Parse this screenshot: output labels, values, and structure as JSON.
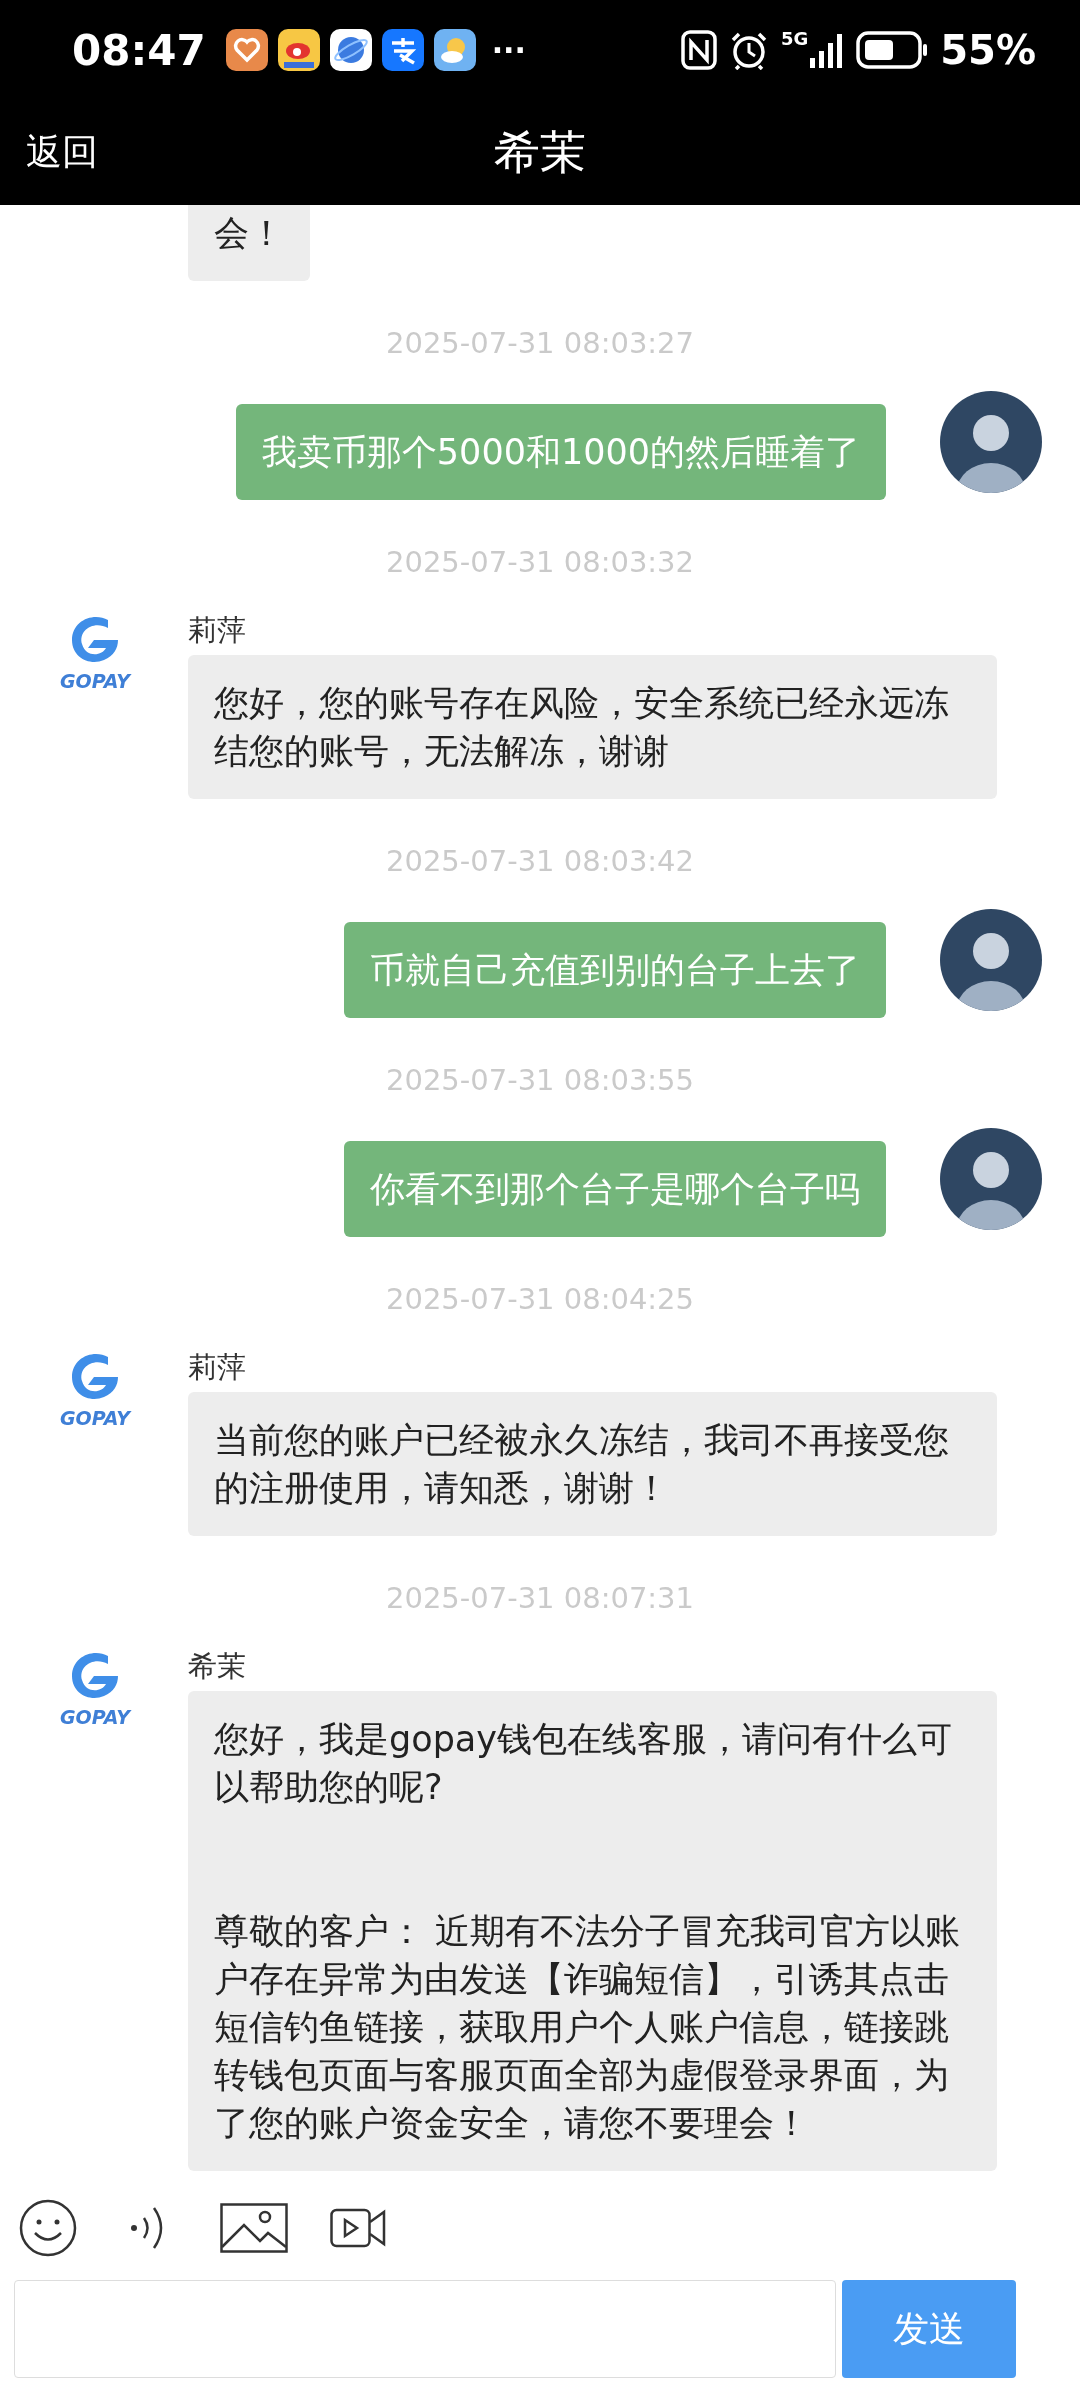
{
  "status_bar": {
    "time": "08:47",
    "overflow": "···",
    "network": "5G",
    "battery": "55%"
  },
  "header": {
    "back": "返回",
    "title": "希茉"
  },
  "items": [
    {
      "kind": "incoming",
      "text": "会！"
    },
    {
      "kind": "timestamp",
      "text": "2025-07-31 08:03:27"
    },
    {
      "kind": "outgoing",
      "text": "我卖币那个5000和1000的然后睡着了"
    },
    {
      "kind": "timestamp",
      "text": "2025-07-31 08:03:32"
    },
    {
      "kind": "incoming",
      "sender": "莉萍",
      "logo_text": "GOPAY",
      "text": "您好，您的账号存在风险，安全系统已经永远冻结您的账号，无法解冻，谢谢"
    },
    {
      "kind": "timestamp",
      "text": "2025-07-31 08:03:42"
    },
    {
      "kind": "outgoing",
      "text": "币就自己充值到别的台子上去了"
    },
    {
      "kind": "timestamp",
      "text": "2025-07-31 08:03:55"
    },
    {
      "kind": "outgoing",
      "text": "你看不到那个台子是哪个台子吗"
    },
    {
      "kind": "timestamp",
      "text": "2025-07-31 08:04:25"
    },
    {
      "kind": "incoming",
      "sender": "莉萍",
      "logo_text": "GOPAY",
      "text": "当前您的账户已经被永久冻结，我司不再接受您的注册使用，请知悉，谢谢！"
    },
    {
      "kind": "timestamp",
      "text": "2025-07-31 08:07:31"
    },
    {
      "kind": "incoming",
      "sender": "希茉",
      "logo_text": "GOPAY",
      "text": "您好，我是gopay钱包在线客服，请问有什么可以帮助您的呢?\n\n\n尊敬的客户： 近期有不法分子冒充我司官方以账户存在异常为由发送【诈骗短信】，引诱其点击短信钓鱼链接，获取用户个人账户信息，链接跳转钱包页面与客服页面全部为虚假登录界面，为了您的账户资金安全，请您不要理会！"
    }
  ],
  "composer": {
    "send": "发送"
  }
}
